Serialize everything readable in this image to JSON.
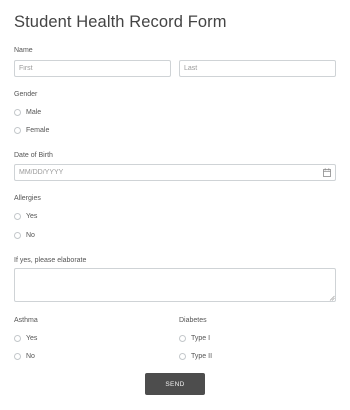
{
  "form": {
    "title": "Student Health Record Form",
    "name": {
      "label": "Name",
      "first_placeholder": "First",
      "last_placeholder": "Last"
    },
    "gender": {
      "label": "Gender",
      "options": [
        "Male",
        "Female"
      ]
    },
    "dob": {
      "label": "Date of Birth",
      "placeholder": "MM/DD/YYYY",
      "icon": "calendar-icon"
    },
    "allergies": {
      "label": "Allergies",
      "options": [
        "Yes",
        "No"
      ]
    },
    "elaborate": {
      "label": "If yes, please elaborate"
    },
    "asthma": {
      "label": "Asthma",
      "options": [
        "Yes",
        "No"
      ]
    },
    "diabetes": {
      "label": "Diabetes",
      "options": [
        "Type I",
        "Type II"
      ]
    },
    "send_label": "SEND"
  },
  "colors": {
    "button": "#4d4d4d",
    "border": "#cfd3d6",
    "text": "#555555"
  }
}
